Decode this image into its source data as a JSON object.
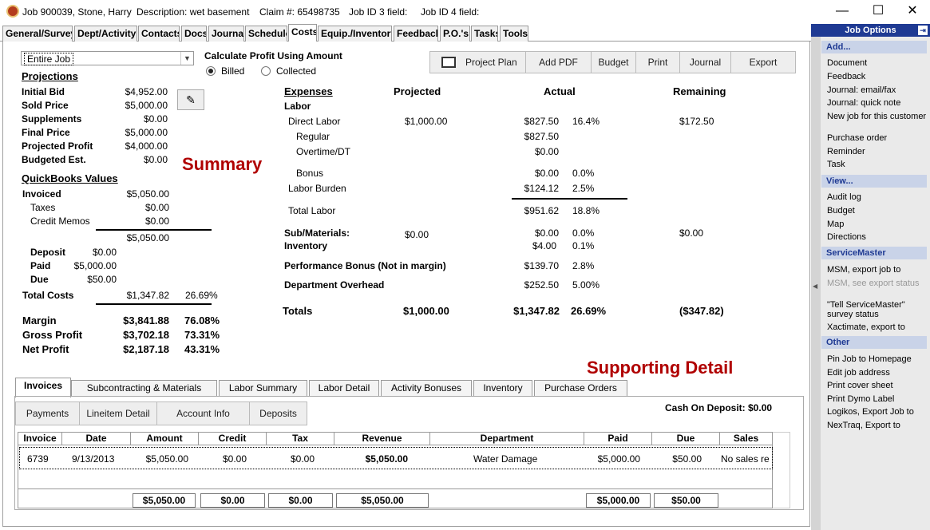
{
  "title_bar": {
    "job": "Job 900039, Stone, Harry",
    "description": "Description: wet basement",
    "claim": "Claim #: 65498735",
    "job_id3": "Job ID 3 field:",
    "job_id4": "Job ID 4 field:"
  },
  "tabs": [
    "General/Survey",
    "Dept/Activity",
    "Contacts",
    "Docs",
    "Journal",
    "Schedule",
    "Costs",
    "Equip./Inventory",
    "Feedback",
    "P.O.'s",
    "Tasks",
    "Tools"
  ],
  "active_tab": "Costs",
  "job_select": "Entire Job",
  "calc_profit": {
    "label": "Calculate Profit Using Amount",
    "billed": "Billed",
    "collected": "Collected",
    "selected": "Billed"
  },
  "actions": [
    "Project Plan",
    "Add PDF",
    "Budget",
    "Print",
    "Journal",
    "Export"
  ],
  "projections": {
    "heading": "Projections",
    "rows": [
      {
        "label": "Initial Bid",
        "value": "$4,952.00"
      },
      {
        "label": "Sold Price",
        "value": "$5,000.00"
      },
      {
        "label": "Supplements",
        "value": "$0.00"
      },
      {
        "label": "Final Price",
        "value": "$5,000.00"
      },
      {
        "label": "Projected Profit",
        "value": "$4,000.00"
      },
      {
        "label": "Budgeted Est.",
        "value": "$0.00"
      }
    ]
  },
  "quickbooks": {
    "heading": "QuickBooks Values",
    "invoiced": {
      "label": "Invoiced",
      "value": "$5,050.00"
    },
    "taxes": {
      "label": "Taxes",
      "value": "$0.00"
    },
    "credit_memos": {
      "label": "Credit Memos",
      "value": "$0.00"
    },
    "subtotal": "$5,050.00",
    "deposit": {
      "label": "Deposit",
      "value": "$0.00"
    },
    "paid": {
      "label": "Paid",
      "value": "$5,000.00"
    },
    "due": {
      "label": "Due",
      "value": "$50.00"
    },
    "total_costs": {
      "label": "Total Costs",
      "value": "$1,347.82",
      "pct": "26.69%"
    }
  },
  "profit": {
    "margin": {
      "label": "Margin",
      "value": "$3,841.88",
      "pct": "76.08%"
    },
    "gross": {
      "label": "Gross Profit",
      "value": "$3,702.18",
      "pct": "73.31%"
    },
    "net": {
      "label": "Net Profit",
      "value": "$2,187.18",
      "pct": "43.31%"
    }
  },
  "summary_label": "Summary",
  "detail_label": "Supporting Detail",
  "expenses": {
    "heading": "Expenses",
    "col_projected": "Projected",
    "col_actual": "Actual",
    "col_remaining": "Remaining",
    "labor": "Labor",
    "direct_labor": {
      "label": "Direct Labor",
      "projected": "$1,000.00",
      "actual": "$827.50",
      "pct": "16.4%",
      "remaining": "$172.50"
    },
    "regular": {
      "label": "Regular",
      "actual": "$827.50"
    },
    "overtime": {
      "label": "Overtime/DT",
      "actual": "$0.00"
    },
    "bonus": {
      "label": "Bonus",
      "actual": "$0.00",
      "pct": "0.0%"
    },
    "labor_burden": {
      "label": "Labor Burden",
      "actual": "$124.12",
      "pct": "2.5%"
    },
    "total_labor": {
      "label": "Total Labor",
      "actual": "$951.62",
      "pct": "18.8%"
    },
    "sub_materials": {
      "label": "Sub/Materials:",
      "projected": "$0.00",
      "actual": "$0.00",
      "pct": "0.0%",
      "remaining": "$0.00"
    },
    "inventory": {
      "label": "Inventory",
      "actual": "$4.00",
      "pct": "0.1%"
    },
    "perf_bonus": {
      "label": "Performance Bonus (Not in margin)",
      "actual": "$139.70",
      "pct": "2.8%"
    },
    "dept_overhead": {
      "label": "Department Overhead",
      "actual": "$252.50",
      "pct": "5.00%"
    },
    "totals": {
      "label": "Totals",
      "projected": "$1,000.00",
      "actual": "$1,347.82",
      "pct": "26.69%",
      "remaining": "($347.82)"
    }
  },
  "detail_tabs": [
    "Invoices",
    "Subcontracting & Materials",
    "Labor Summary",
    "Labor Detail",
    "Activity Bonuses",
    "Inventory",
    "Purchase Orders"
  ],
  "sub_buttons": [
    "Payments",
    "Lineitem Detail",
    "Account Info",
    "Deposits"
  ],
  "cash_on_deposit": "Cash On Deposit: $0.00",
  "grid": {
    "headers": [
      "Invoice",
      "Date",
      "Amount",
      "Credit",
      "Tax",
      "Revenue",
      "Department",
      "Paid",
      "Due",
      "Sales"
    ],
    "row": [
      "6739",
      "9/13/2013",
      "$5,050.00",
      "$0.00",
      "$0.00",
      "$5,050.00",
      "Water Damage",
      "$5,000.00",
      "$50.00",
      "No sales re"
    ],
    "totals": {
      "amount": "$5,050.00",
      "credit": "$0.00",
      "tax": "$0.00",
      "revenue": "$5,050.00",
      "paid": "$5,000.00",
      "due": "$50.00"
    }
  },
  "job_options": {
    "title": "Job Options",
    "add": {
      "heading": "Add...",
      "items": [
        "Document",
        "Feedback",
        "Journal: email/fax",
        "Journal: quick note",
        "New job for this customer",
        "Purchase order",
        "Reminder",
        "Task"
      ]
    },
    "view": {
      "heading": "View...",
      "items": [
        "Audit log",
        "Budget",
        "Map",
        "Directions"
      ]
    },
    "servicemaster": {
      "heading": "ServiceMaster",
      "items": [
        "MSM, export job to",
        "MSM, see export status",
        "\"Tell ServiceMaster\" survey status",
        "Xactimate, export to"
      ]
    },
    "other": {
      "heading": "Other",
      "items": [
        "Pin Job to Homepage",
        "Edit job address",
        "Print cover sheet",
        "Print Dymo Label",
        "Logikos, Export Job to",
        "NexTraq, Export to"
      ]
    }
  }
}
